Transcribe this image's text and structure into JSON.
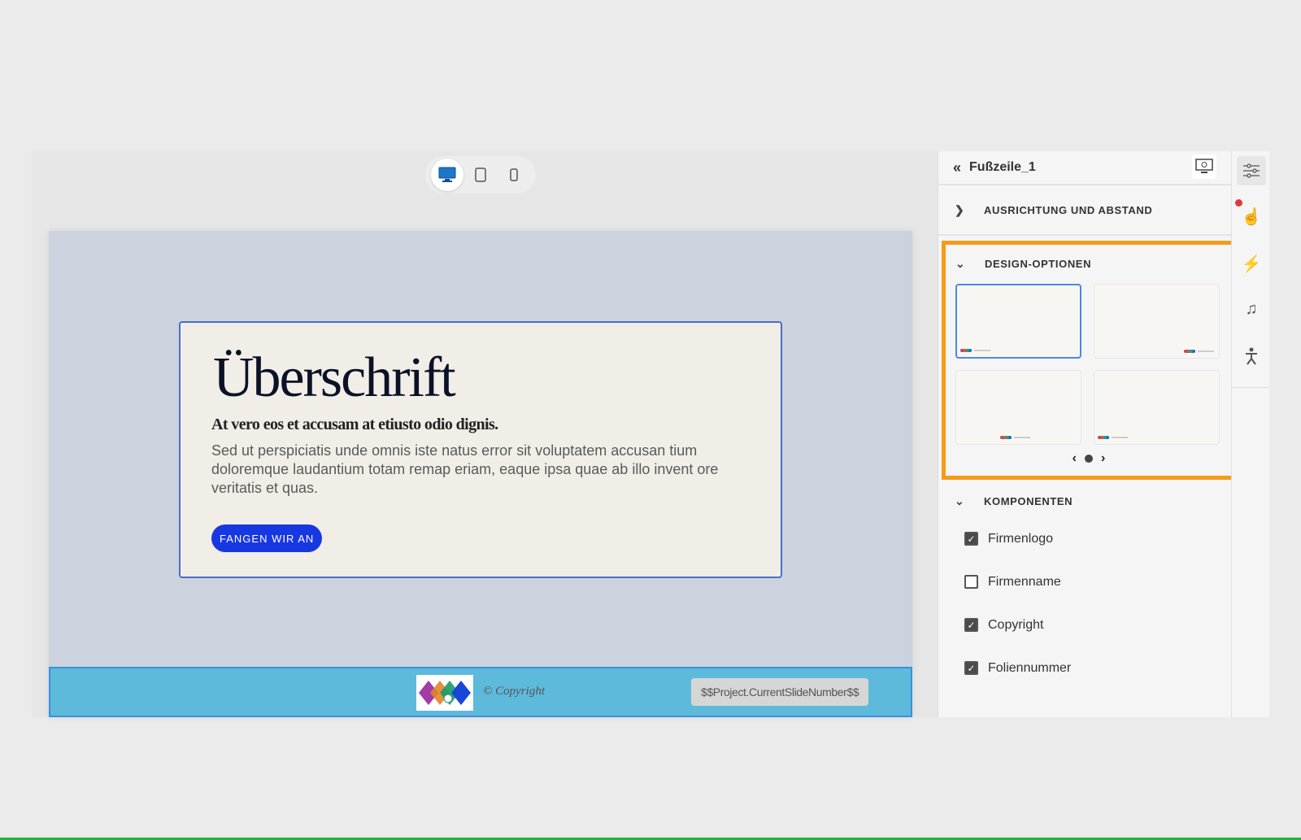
{
  "device_toggle": {
    "desktop": "desktop",
    "tablet": "tablet",
    "mobile": "mobile"
  },
  "slide": {
    "heading": "Überschrift",
    "subheading": "At vero eos et accusam at etiusto odio dignis.",
    "body": "Sed ut perspiciatis unde omnis iste natus error sit voluptatem accusan tium doloremque laudantium totam remap eriam, eaque ipsa quae ab illo invent ore veritatis et quas.",
    "cta": "FANGEN WIR AN",
    "footer": {
      "copyright": "© Copyright",
      "slide_number": "$$Project.CurrentSlideNumber$$"
    }
  },
  "panel": {
    "title": "Fußzeile_1",
    "sections": {
      "alignment": "AUSRICHTUNG UND ABSTAND",
      "design": "DESIGN-OPTIONEN",
      "components": "KOMPONENTEN"
    },
    "design_selected": 1,
    "components": [
      {
        "label": "Firmenlogo",
        "checked": true
      },
      {
        "label": "Firmenname",
        "checked": false
      },
      {
        "label": "Copyright",
        "checked": true
      },
      {
        "label": "Foliennummer",
        "checked": true
      }
    ]
  },
  "colors": {
    "highlight": "#f39c1a",
    "cta": "#1738e0",
    "footer": "#5dbadb",
    "selected": "#4a8be0"
  }
}
